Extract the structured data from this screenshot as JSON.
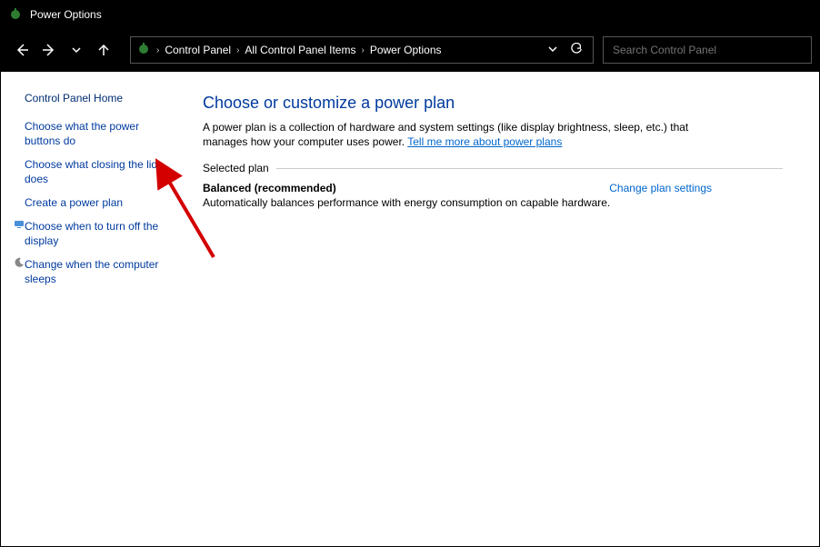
{
  "titlebar": {
    "title": "Power Options"
  },
  "breadcrumb": {
    "items": [
      "Control Panel",
      "All Control Panel Items",
      "Power Options"
    ]
  },
  "search": {
    "placeholder": "Search Control Panel"
  },
  "sidebar": {
    "home": "Control Panel Home",
    "items": [
      {
        "label": "Choose what the power buttons do",
        "icon": ""
      },
      {
        "label": "Choose what closing the lid does",
        "icon": ""
      },
      {
        "label": "Create a power plan",
        "icon": ""
      },
      {
        "label": "Choose when to turn off the display",
        "icon": "monitor"
      },
      {
        "label": "Change when the computer sleeps",
        "icon": "moon"
      }
    ]
  },
  "main": {
    "heading": "Choose or customize a power plan",
    "description": "A power plan is a collection of hardware and system settings (like display brightness, sleep, etc.) that manages how your computer uses power. ",
    "description_link": "Tell me more about power plans",
    "group_label": "Selected plan",
    "plan": {
      "name": "Balanced (recommended)",
      "change_link": "Change plan settings",
      "desc": "Automatically balances performance with energy consumption on capable hardware."
    }
  }
}
